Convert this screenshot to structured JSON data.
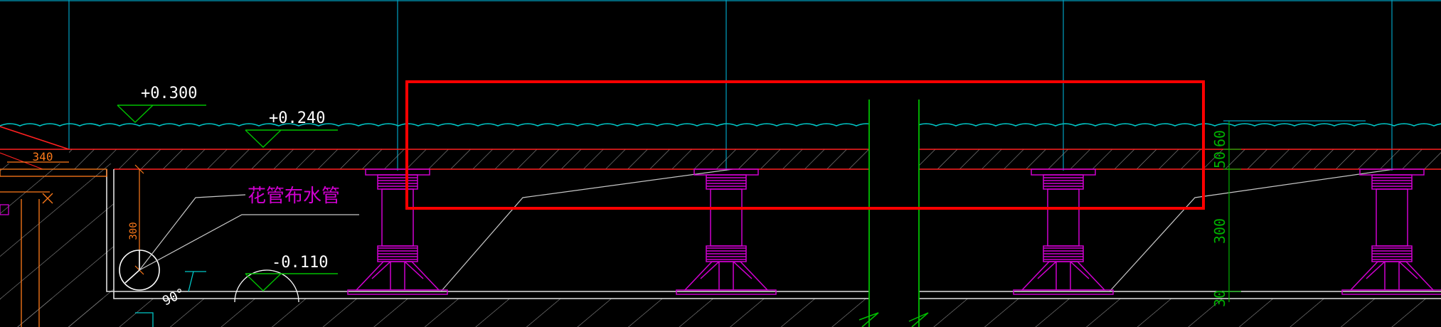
{
  "drawing": {
    "background": "#000000",
    "colors": {
      "water": "#00c8c8",
      "slab": "#ff2020",
      "grid": "#00a0c0",
      "pedestal": "#d000d0",
      "level_mark": "#00c000",
      "level_text": "#ffffff",
      "pipe": "#ffffff",
      "dimension": "#ff7a1a",
      "dimension_green": "#00b000",
      "pier": "#00c000",
      "highlight": "#ff0000",
      "leader": "#c8c8c8",
      "hatch": "#bdbdbd"
    }
  },
  "labels": {
    "level_top": "+0.300",
    "level_water": "+0.240",
    "level_base": "-0.110",
    "pipe_note": "花管布水管",
    "angle": "90°"
  },
  "dimensions": {
    "left_width": "340",
    "left_height": "300",
    "right_top": "60",
    "right_slab": "50",
    "right_void": "300",
    "right_bottom": "30"
  },
  "pedestal_count": 4
}
